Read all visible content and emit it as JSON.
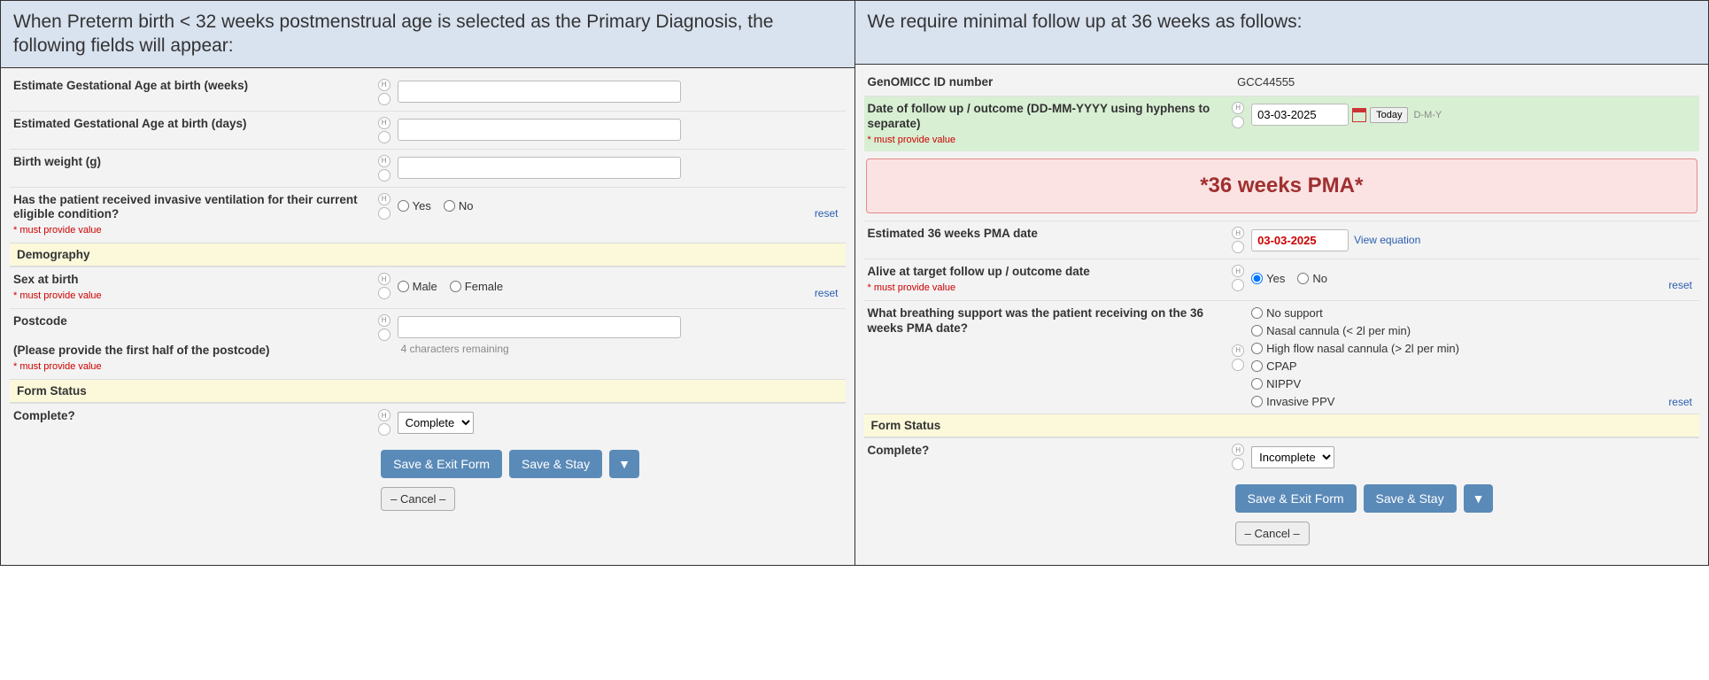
{
  "left": {
    "header": "When Preterm birth < 32 weeks postmenstrual age is selected as the Primary Diagnosis, the following fields will appear:",
    "fields": {
      "ega_weeks": "Estimate Gestational Age at birth (weeks)",
      "ega_days": "Estimated Gestational Age at birth (days)",
      "bw": "Birth weight (g)",
      "invvent": "Has the patient received invasive ventilation for their current eligible condition?",
      "sex": "Sex at birth",
      "postcode_line1": "Postcode",
      "postcode_line2": "(Please provide the first half of the postcode)",
      "postcode_hint": "4 characters remaining",
      "complete": "Complete?"
    },
    "sections": {
      "demography": "Demography",
      "form_status": "Form Status"
    },
    "options": {
      "yes": "Yes",
      "no": "No",
      "male": "Male",
      "female": "Female"
    },
    "complete_value": "Complete"
  },
  "right": {
    "header": "We require minimal follow up at 36 weeks as follows:",
    "genomicc_label": "GenOMICC ID number",
    "genomicc_value": "GCC44555",
    "followup_label": "Date of follow up / outcome (DD-MM-YYYY using hyphens to separate)",
    "followup_value": "03-03-2025",
    "today": "Today",
    "dmy": "D-M-Y",
    "banner": "*36 weeks PMA*",
    "est_36_label": "Estimated 36 weeks PMA date",
    "est_36_value": "03-03-2025",
    "view_eq": "View equation",
    "alive_label": "Alive at target follow up / outcome date",
    "breathing_label": "What breathing support was the patient receiving on the 36 weeks PMA date?",
    "breathing_options": {
      "a": "No support",
      "b": "Nasal cannula (< 2l per min)",
      "c": "High flow nasal cannula (> 2l per min)",
      "d": "CPAP",
      "e": "NIPPV",
      "f": "Invasive PPV"
    },
    "options": {
      "yes": "Yes",
      "no": "No"
    },
    "sections": {
      "form_status": "Form Status"
    },
    "complete_label": "Complete?",
    "complete_value": "Incomplete"
  },
  "common": {
    "must": "* must provide value",
    "reset": "reset",
    "save_exit": "Save & Exit Form",
    "save_stay": "Save & Stay",
    "cancel": "– Cancel –"
  }
}
